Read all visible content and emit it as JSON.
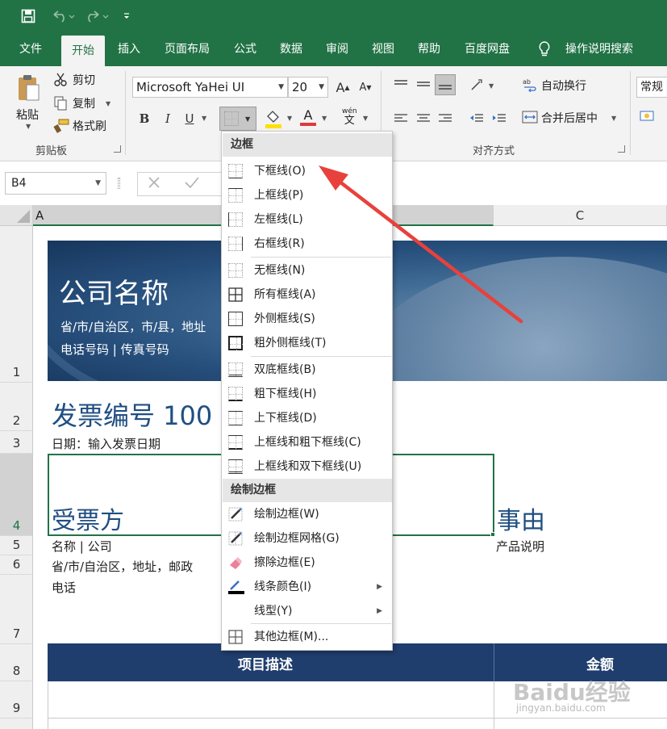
{
  "qat": {
    "save_icon": "save-icon",
    "undo_icon": "undo-icon",
    "redo_icon": "redo-icon",
    "customize_icon": "customize-qat-icon"
  },
  "tabs": [
    {
      "label": "文件"
    },
    {
      "label": "开始"
    },
    {
      "label": "插入"
    },
    {
      "label": "页面布局"
    },
    {
      "label": "公式"
    },
    {
      "label": "数据"
    },
    {
      "label": "审阅"
    },
    {
      "label": "视图"
    },
    {
      "label": "帮助"
    },
    {
      "label": "百度网盘"
    }
  ],
  "tell_me": {
    "label": "操作说明搜索"
  },
  "ribbon": {
    "clipboard": {
      "paste_label": "粘贴",
      "cut_label": "剪切",
      "copy_label": "复制",
      "format_painter_label": "格式刷",
      "group_label": "剪贴板"
    },
    "font": {
      "font_name": "Microsoft YaHei UI",
      "font_size": "20",
      "bold": "B",
      "italic": "I",
      "underline": "U",
      "grow": "A",
      "shrink": "A",
      "font_color_letter": "A",
      "font_color": "#e03a3a",
      "fill_color": "#ffe000",
      "wen_pinyin": "wén",
      "wen_char": "文"
    },
    "alignment": {
      "wrap_text_label": "自动换行",
      "merge_center_label": "合并后居中",
      "group_label": "对齐方式"
    },
    "number": {
      "format_label": "常规"
    }
  },
  "formula_bar": {
    "name_box": "B4",
    "cancel_icon": "cancel-icon",
    "enter_icon": "enter-icon"
  },
  "sheet": {
    "columns": [
      {
        "label": "A"
      },
      {
        "label": "C"
      }
    ],
    "rows": [
      "1",
      "2",
      "3",
      "4",
      "5",
      "6",
      "7",
      "8",
      "9"
    ],
    "banner": {
      "company_name": "公司名称",
      "address": "省/市/自治区，市/县，地址",
      "phone": "电话号码 | 传真号码"
    },
    "invoice_no": "发票编号 100",
    "date": "日期：输入发票日期",
    "bill_to": "受票方",
    "reason": "事由",
    "name_company": "名称 | 公司",
    "address_line": "省/市/自治区，地址，邮政",
    "phone_line": "电话",
    "product_desc": "产品说明",
    "table_headers": {
      "item_desc": "项目描述",
      "amount": "金额"
    },
    "header_color": "#1f3e6e",
    "title_color": "#1f4e82"
  },
  "border_menu": {
    "section1": "边框",
    "items1": [
      {
        "label": "下框线(O)",
        "icon": "bottom-border-icon"
      },
      {
        "label": "上框线(P)",
        "icon": "top-border-icon"
      },
      {
        "label": "左框线(L)",
        "icon": "left-border-icon"
      },
      {
        "label": "右框线(R)",
        "icon": "right-border-icon"
      },
      {
        "label": "无框线(N)",
        "icon": "no-border-icon"
      },
      {
        "label": "所有框线(A)",
        "icon": "all-borders-icon"
      },
      {
        "label": "外侧框线(S)",
        "icon": "outside-borders-icon"
      },
      {
        "label": "粗外侧框线(T)",
        "icon": "thick-outside-borders-icon"
      },
      {
        "label": "双底框线(B)",
        "icon": "double-bottom-border-icon"
      },
      {
        "label": "粗下框线(H)",
        "icon": "thick-bottom-border-icon"
      },
      {
        "label": "上下框线(D)",
        "icon": "top-bottom-border-icon"
      },
      {
        "label": "上框线和粗下框线(C)",
        "icon": "top-thick-bottom-border-icon"
      },
      {
        "label": "上框线和双下框线(U)",
        "icon": "top-double-bottom-border-icon"
      }
    ],
    "section2": "绘制边框",
    "items2": [
      {
        "label": "绘制边框(W)",
        "icon": "draw-border-icon"
      },
      {
        "label": "绘制边框网格(G)",
        "icon": "draw-border-grid-icon"
      },
      {
        "label": "擦除边框(E)",
        "icon": "eraser-icon"
      },
      {
        "label": "线条颜色(I)",
        "icon": "line-color-icon"
      },
      {
        "label": "线型(Y)",
        "icon": "line-style-icon"
      },
      {
        "label": "其他边框(M)...",
        "icon": "more-borders-icon"
      }
    ]
  },
  "annotation": {
    "arrow_color": "#e8413c"
  },
  "watermark": {
    "brand": "Baidu经验",
    "url": "jingyan.baidu.com"
  }
}
